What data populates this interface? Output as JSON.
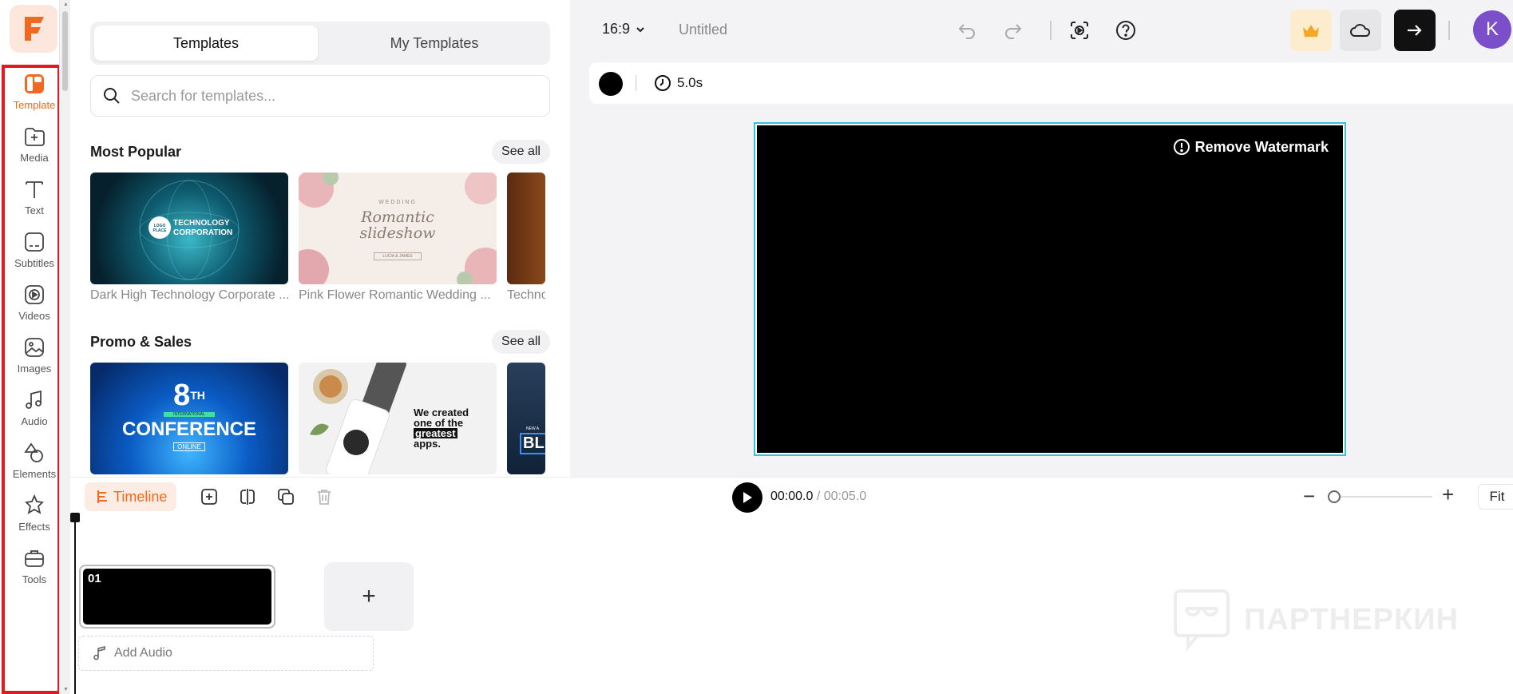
{
  "sidebar": {
    "items": [
      {
        "label": "Template",
        "icon": "template-icon",
        "active": true
      },
      {
        "label": "Media",
        "icon": "media-icon"
      },
      {
        "label": "Text",
        "icon": "text-icon"
      },
      {
        "label": "Subtitles",
        "icon": "subtitles-icon"
      },
      {
        "label": "Videos",
        "icon": "videos-icon"
      },
      {
        "label": "Images",
        "icon": "images-icon"
      },
      {
        "label": "Audio",
        "icon": "audio-icon"
      },
      {
        "label": "Elements",
        "icon": "elements-icon"
      },
      {
        "label": "Effects",
        "icon": "effects-icon"
      },
      {
        "label": "Tools",
        "icon": "tools-icon"
      }
    ],
    "logo_letter": "F"
  },
  "panel": {
    "tabs": [
      "Templates",
      "My Templates"
    ],
    "search_placeholder": "Search for templates...",
    "sections": [
      {
        "title": "Most Popular",
        "see_all": "See all",
        "items": [
          {
            "caption": "Dark High Technology Corporate ...",
            "thumb_text": "TECHNOLOGY CORPORATION",
            "logo_text": "LOGO PLACE"
          },
          {
            "caption": "Pink Flower Romantic Wedding ...",
            "thumb_small": "WEDDING",
            "thumb_text": "Romantic slideshow",
            "thumb_names": "LUCIA & JAMES"
          },
          {
            "caption": "Techno"
          }
        ]
      },
      {
        "title": "Promo & Sales",
        "see_all": "See all",
        "items": [
          {
            "thumb_num": "8",
            "thumb_sup": "TH",
            "thumb_small": "INTERNATIONAL",
            "thumb_text": "CONFERENCE",
            "thumb_sub": "ONLINE"
          },
          {
            "thumb_text_lines": [
              "We created",
              "one of the",
              "greatest",
              "apps."
            ]
          },
          {
            "thumb_small": "NEW A",
            "thumb_text": "BL"
          }
        ]
      }
    ]
  },
  "editor": {
    "aspect_ratio": "16:9",
    "title": "Untitled",
    "duration": "5.0s",
    "watermark_button": "Remove Watermark",
    "avatar_letter": "K",
    "colors": {
      "accent": "#f0691f",
      "canvas_border": "#35c3d4",
      "avatar": "#7a4fc9",
      "highlight": "#e11b22"
    }
  },
  "timeline": {
    "label": "Timeline",
    "current_time": "00:00.0",
    "separator": " / ",
    "total_time": "00:05.0",
    "fit_label": "Fit",
    "clip_label": "01",
    "add_audio_label": "Add Audio",
    "add_clip_symbol": "+",
    "watermark_text": "ПАРТНЕРКИН"
  }
}
